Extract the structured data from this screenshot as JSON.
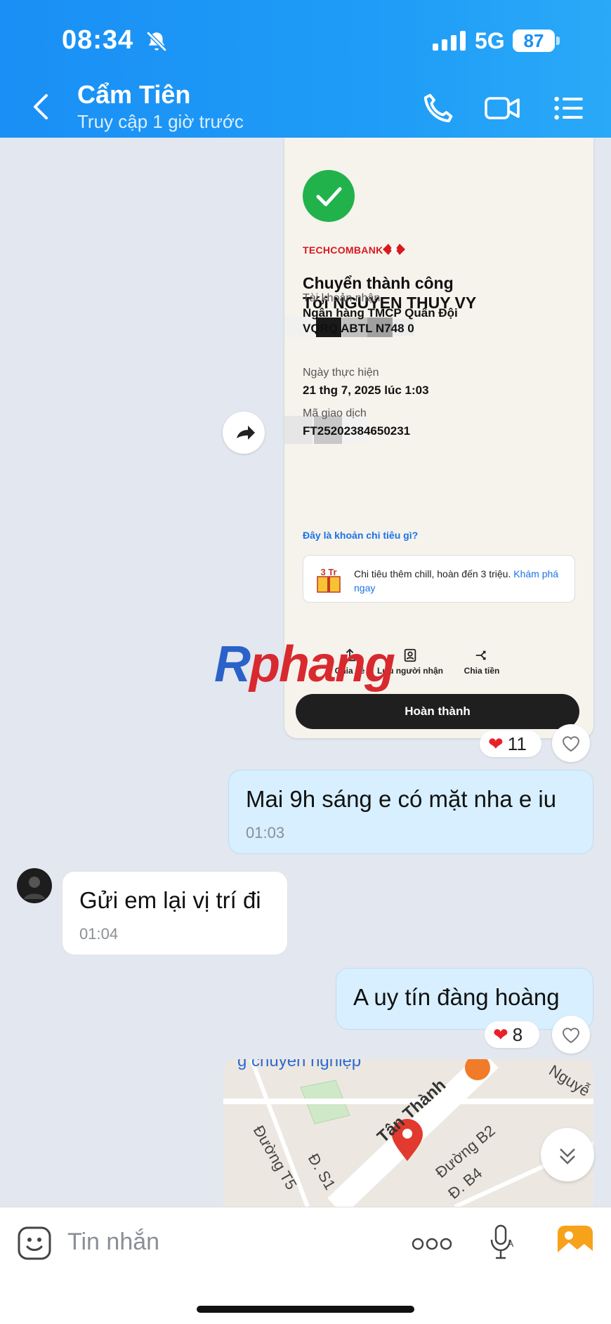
{
  "status_bar": {
    "time": "08:34",
    "network": "5G",
    "battery": "87"
  },
  "header": {
    "contact_name": "Cẩm Tiên",
    "contact_status": "Truy cập 1 giờ trước"
  },
  "receipt": {
    "bank_name": "TECHCOMBANK",
    "title": "Chuyển thành công",
    "recipient": "Tới NGUYEN THUY VY",
    "account_label": "Tài khoản nhận",
    "account_bank": "Ngân hàng TMCP Quân Đội",
    "account_number": "VQRQ ABTL N748 0",
    "date_label": "Ngày thực hiện",
    "date_value": "21 thg 7, 2025 lúc 1:03",
    "txn_label": "Mã giao dịch",
    "txn_value": "FT25202384650231",
    "spend_link": "Đây là khoản chi tiêu gì?",
    "promo_text": "Chi tiêu thêm chill, hoàn đến 3 triệu.",
    "promo_link": "Khám phá ngay",
    "promo_badge": "3 Tr",
    "actions": [
      "Chia sẻ",
      "Lưu người nhận",
      "Chia tiền"
    ],
    "done_button": "Hoàn thành"
  },
  "watermark": {
    "part1": "R",
    "part2": "phang"
  },
  "reactions": [
    {
      "emoji": "❤",
      "count": "11"
    },
    {
      "emoji": "❤",
      "count": "8"
    }
  ],
  "messages": [
    {
      "text": "Mai 9h sáng e có mặt nha e iu",
      "time": "01:03"
    },
    {
      "text": "Gửi em lại vị trí đi",
      "time": "01:04"
    },
    {
      "text": "A uy tín đàng hoàng"
    }
  ],
  "map": {
    "labels": [
      "g chuyên nghiệp",
      "Nguyễ",
      "Tân Thành",
      "Đường B2",
      "Đường T5",
      "Đ. S1",
      "Đ. B4"
    ]
  },
  "composer": {
    "placeholder": "Tin nhắn"
  },
  "colors": {
    "header": "#1a8ff5",
    "bubble_me": "#d7efff",
    "heart": "#e8202a",
    "check": "#22b24c"
  }
}
